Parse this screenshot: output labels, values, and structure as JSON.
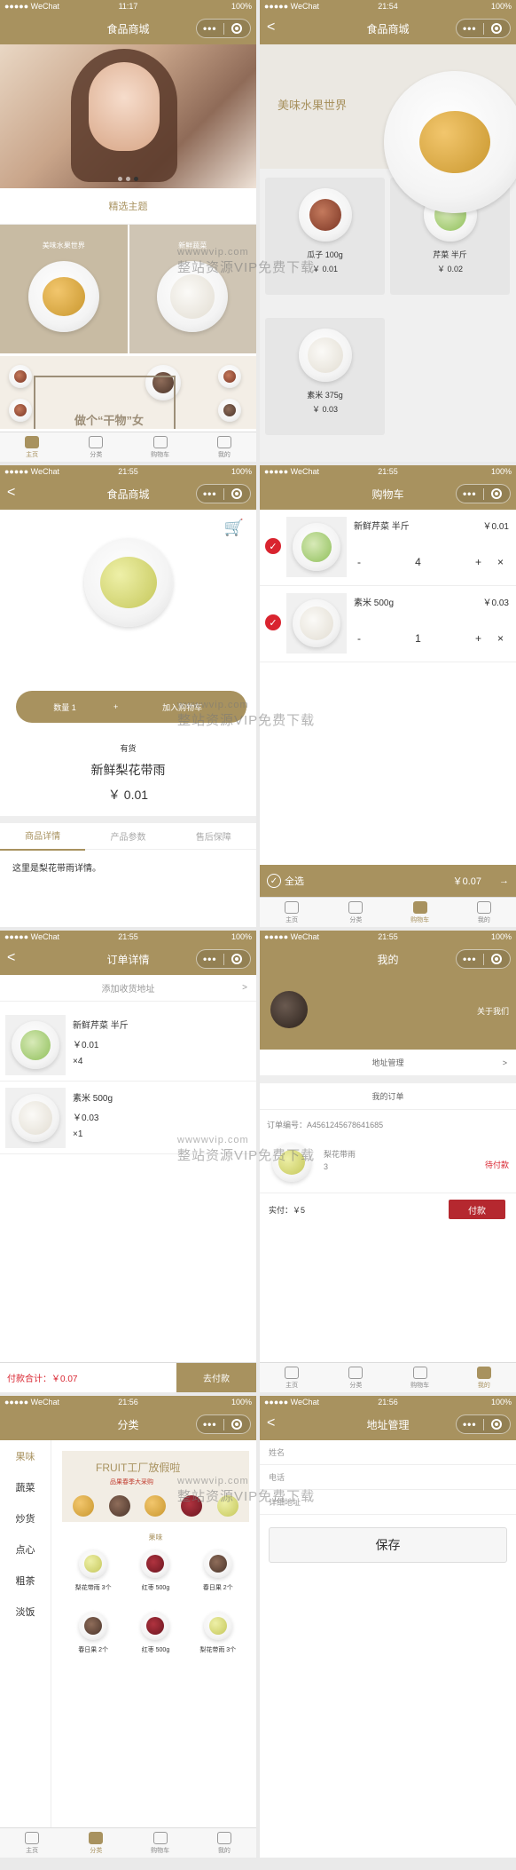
{
  "status": {
    "carrier": "●●●●● WeChat",
    "battery": "100%",
    "times": [
      "11:17",
      "21:54",
      "21:55",
      "21:55",
      "21:55",
      "21:55",
      "21:56",
      "21:56"
    ]
  },
  "capsule": {
    "dots": "•••"
  },
  "tabbar": {
    "home": "主页",
    "category": "分类",
    "cart": "购物车",
    "mine": "我的"
  },
  "screen1": {
    "title": "食品商城",
    "theme_title": "精选主题",
    "cell_left": "美味水果世界",
    "cell_right": "新鲜蔬菜",
    "banner_text": "做个“干物”女"
  },
  "screen2": {
    "title": "食品商城",
    "banner_text": "美味水果世界",
    "products": [
      {
        "name": "瓜子 100g",
        "price": "￥ 0.01",
        "food": "f-seeds"
      },
      {
        "name": "芹菜 半斤",
        "price": "￥ 0.02",
        "food": "f-celery"
      },
      {
        "name": "素米 375g",
        "price": "￥ 0.03",
        "food": "f-rice"
      }
    ]
  },
  "screen3": {
    "title": "食品商城",
    "qty_label": "数量 1",
    "plus": "+",
    "add_cart": "加入购物车",
    "stock": "有货",
    "name": "新鲜梨花带雨",
    "price": "￥ 0.01",
    "tabs": [
      "商品详情",
      "产品参数",
      "售后保障"
    ],
    "description": "这里是梨花带雨详情。"
  },
  "screen4": {
    "title": "购物车",
    "items": [
      {
        "name": "新鲜芹菜 半斤",
        "price": "￥0.01",
        "qty": "4",
        "food": "f-celery"
      },
      {
        "name": "素米 500g",
        "price": "￥0.03",
        "qty": "1",
        "food": "f-rice"
      }
    ],
    "minus": "-",
    "plus": "+",
    "del": "×",
    "check": "✓",
    "select_all": "全选",
    "total": "￥0.07",
    "next": "→"
  },
  "screen5": {
    "title": "订单详情",
    "add_address": "添加收货地址",
    "arrow": ">",
    "items": [
      {
        "name": "新鲜芹菜 半斤",
        "price": "￥0.01",
        "count": "×4",
        "food": "f-celery"
      },
      {
        "name": "素米 500g",
        "price": "￥0.03",
        "count": "×1",
        "food": "f-rice"
      }
    ],
    "total": "付款合计：￥0.07",
    "pay": "去付款"
  },
  "screen6": {
    "title": "我的",
    "about": "关于我们",
    "address_mgmt": "地址管理",
    "my_orders": "我的订单",
    "order_no": "订单编号：A4561245678641685",
    "order_item_name": "梨花带雨",
    "order_item_count": "3",
    "order_status": "待付款",
    "amount": "实付：￥5",
    "pay": "付款"
  },
  "screen7": {
    "title": "分类",
    "sidebar": [
      "果味",
      "蔬菜",
      "炒货",
      "点心",
      "粗茶",
      "淡饭"
    ],
    "banner_t1": "FRUIT工厂放假啦",
    "banner_t2": "品果春季大采购",
    "section": "果味",
    "items": [
      {
        "name": "梨花带雨 3个",
        "food": "f-pear"
      },
      {
        "name": "红枣 500g",
        "food": "f-date"
      },
      {
        "name": "春日果 2个",
        "food": "f-nut"
      },
      {
        "name": "春日果 2个",
        "food": "f-nut"
      },
      {
        "name": "红枣 500g",
        "food": "f-date"
      },
      {
        "name": "梨花带雨 3个",
        "food": "f-pear"
      }
    ]
  },
  "screen8": {
    "title": "地址管理",
    "fields": [
      "姓名",
      "电话",
      "详细地址"
    ],
    "save": "保存"
  },
  "back": "<",
  "watermark": {
    "line1": "wwwwvip.com",
    "line2": "整站资源VIP免费下载"
  }
}
